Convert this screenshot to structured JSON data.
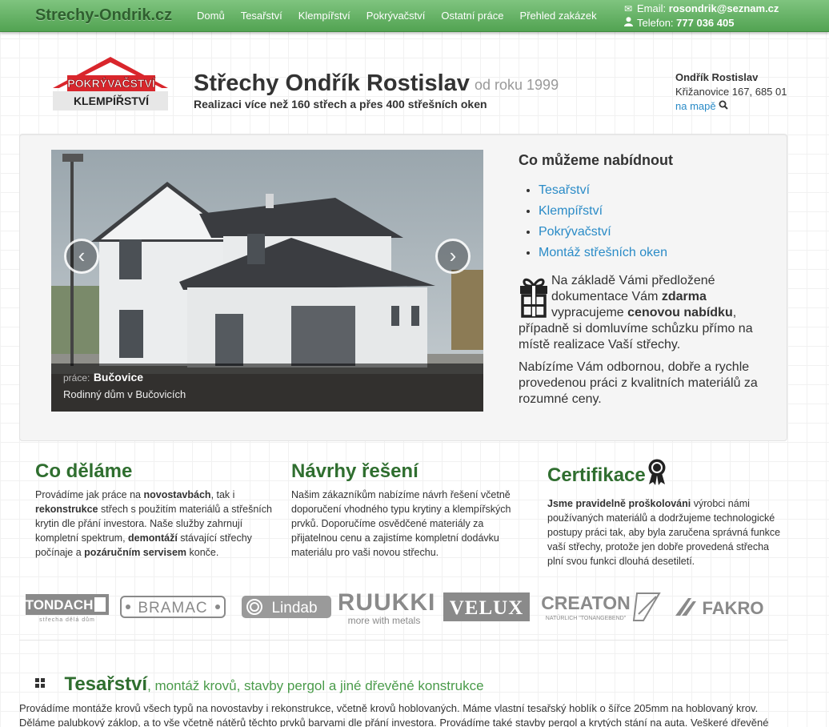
{
  "navbar": {
    "brand": "Strechy-Ondrik.cz",
    "items": [
      "Domů",
      "Tesařství",
      "Klempířství",
      "Pokrývačství",
      "Ostatní práce",
      "Přehled zakázek"
    ],
    "email_label": "Email:",
    "email_value": "rosondrik@seznam.cz",
    "phone_label": "Telefon:",
    "phone_value": "777 036 405"
  },
  "logo": {
    "line1": "POKRÝVAČSTVÍ",
    "line2": "KLEMPÍŘSTVÍ"
  },
  "header": {
    "title": "Střechy Ondřík Rostislav",
    "since": "od roku 1999",
    "tagline": "Realizaci více než 160 střech a přes 400 střešních oken"
  },
  "address": {
    "name": "Ondřík Rostislav",
    "street": "Křižanovice 167, 685 01",
    "map_link": "na mapě"
  },
  "carousel": {
    "caption_label": "práce:",
    "caption_place": "Bučovice",
    "caption_desc": "Rodinný dům v Bučovicích",
    "prev": "‹",
    "next": "›"
  },
  "offer": {
    "title": "Co můžeme nabídnout",
    "items": [
      "Tesařství",
      "Klempířství",
      "Pokrývačství",
      "Montáž střešních oken"
    ],
    "p1_a": "Na základě Vámi předložené dokumentace Vám ",
    "p1_b": "zdarma",
    "p1_c": " vypracujeme ",
    "p1_d": "cenovou nabídku",
    "p1_e": ", případně si domluvíme schůzku přímo na místě realizace Vaší střechy.",
    "p2": "Nabízíme Vám odbornou, dobře a rychle provedenou práci z kvalitních materiálů za rozumné ceny."
  },
  "columns": {
    "c1": {
      "title": "Co děláme",
      "t1": "Provádíme jak práce na ",
      "b1": "novostavbách",
      "t2": ", tak i ",
      "b2": "rekonstrukce",
      "t3": " střech s použitím materiálů a střešních krytin dle přání investora. Naše služby zahrnují kompletní spektrum, ",
      "b3": "demontáží",
      "t4": " stávající střechy počínaje a ",
      "b4": "pozáručním servisem",
      "t5": " konče."
    },
    "c2": {
      "title": "Návrhy řešení",
      "text": "Našim zákazníkům nabízíme návrh řešení včetně doporučení vhodného typu krytiny a klempířských prvků. Doporučíme osvědčené materiály za přijatelnou cenu a zajistíme kompletní dodávku materiálu pro vaši novou střechu."
    },
    "c3": {
      "title": "Certifikace",
      "b1": "Jsme pravidelně proškolováni",
      "t1": " výrobci námi používaných materiálů a dodržujeme technologické postupy práci tak, aby byla zaručena správná funkce vaší střechy, protože jen dobře provedená střecha plní svou funkci dlouhá desetiletí."
    }
  },
  "brands": {
    "tondach": "TONDACH",
    "tondach_sub": "střecha dělá dům",
    "bramac": "BRAMAC",
    "lindab": "Lindab",
    "ruukki": "RUUKKI",
    "ruukki_sub": "more with metals",
    "velux": "VELUX",
    "creaton": "CREATON",
    "creaton_sub": "NATÜRLICH \"TONANGEBEND\"",
    "fakro": "FAKRO"
  },
  "section": {
    "title": "Tesařství",
    "subtitle": ", montáž krovů, stavby pergol a jiné dřevěné konstrukce",
    "text": "Provádíme montáže krovů všech typů na novostavby i rekonstrukce, včetně krovů hoblovaných. Máme vlastní tesařský hoblík o šířce 205mm na hoblovaný krov. Děláme palubkový záklop, a to vše včetně nátěrů těchto prvků barvami dle přání investora. Provádíme také stavby pergol a krytých stání na auta. Veškeré dřevěné"
  },
  "colors": {
    "navbar": "#52a352",
    "heading_green": "#2f6e2f",
    "link": "#2a8bc7"
  }
}
